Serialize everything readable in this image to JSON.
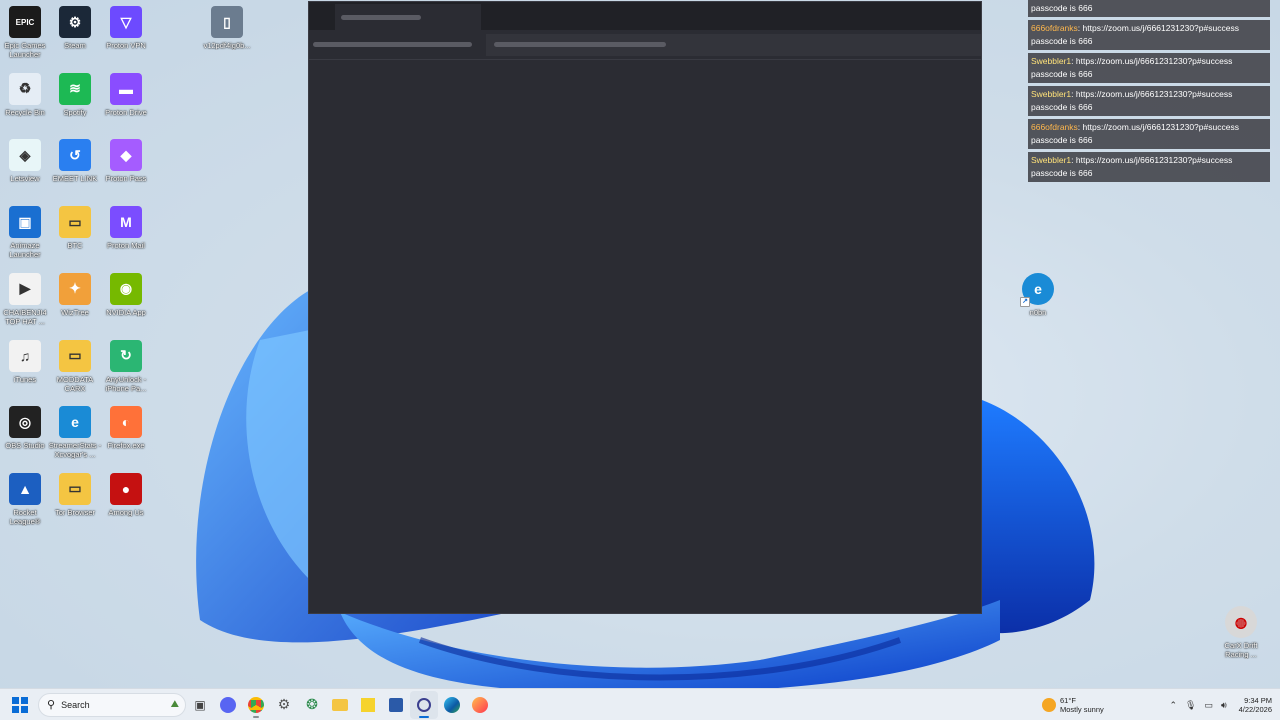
{
  "desktop": {
    "icons_left": [
      {
        "label": "Epic Games Launcher",
        "glyph": "EPIC",
        "color": "#1b1b1b"
      },
      {
        "label": "Steam",
        "glyph": "⚙",
        "color": "#1b2838"
      },
      {
        "label": "Proton VPN",
        "glyph": "▽",
        "color": "#6d4aff"
      },
      {
        "label": "Recycle Bin",
        "glyph": "♻",
        "color": "#e5edf5"
      },
      {
        "label": "Spotify",
        "glyph": "≋",
        "color": "#1db954"
      },
      {
        "label": "Proton Drive",
        "glyph": "▬",
        "color": "#8a4dff"
      },
      {
        "label": "Letsview",
        "glyph": "◈",
        "color": "#e8f6f8"
      },
      {
        "label": "EMEET LINK",
        "glyph": "↺",
        "color": "#2a7ff0"
      },
      {
        "label": "Proton Pass",
        "glyph": "◆",
        "color": "#a55cff"
      },
      {
        "label": "Animaze Launcher",
        "glyph": "▣",
        "color": "#1a6fd1"
      },
      {
        "label": "BTC",
        "glyph": "▭",
        "color": "#f4c542"
      },
      {
        "label": "Proton Mail",
        "glyph": "M",
        "color": "#7b4dff"
      },
      {
        "label": "CHAIBENJI4 TOP HAT ...",
        "glyph": "▶",
        "color": "#f2f2f2"
      },
      {
        "label": "WizTree",
        "glyph": "✦",
        "color": "#f1a03a"
      },
      {
        "label": "NVIDIA App",
        "glyph": "◉",
        "color": "#76b900"
      },
      {
        "label": "iTunes",
        "glyph": "♫",
        "color": "#f2f2f2"
      },
      {
        "label": "MODDATA CARX",
        "glyph": "▭",
        "color": "#f4c542"
      },
      {
        "label": "AnyUnlock - iPhone Pa...",
        "glyph": "↻",
        "color": "#2bb673"
      },
      {
        "label": "OBS Studio",
        "glyph": "◎",
        "color": "#222"
      },
      {
        "label": "StreamerStats - Xcvogar's ...",
        "glyph": "e",
        "color": "#1a8bd6"
      },
      {
        "label": "Firefox.exe",
        "glyph": "◐",
        "color": "#ff7139"
      },
      {
        "label": "Rocket League®",
        "glyph": "▲",
        "color": "#1c5fc1"
      },
      {
        "label": "Tor Browser",
        "glyph": "▭",
        "color": "#f4c542"
      },
      {
        "label": "Among Us",
        "glyph": "●",
        "color": "#c51111"
      }
    ],
    "icon_top": {
      "label": "v12pdf4ig0b...",
      "glyph": "▯",
      "color": "#6b7c8f"
    },
    "icon_right1": {
      "label": "n0bn",
      "glyph": "e",
      "color": "#1a8bd6"
    },
    "icon_right2": {
      "label": "CarX Drift Racing ...",
      "glyph": "◍",
      "color": "#d8d8d8"
    }
  },
  "chat": [
    {
      "user": "",
      "text": "passcode is 666"
    },
    {
      "user": "666ofdranks",
      "text": "https://zoom.us/j/6661231230?p#success passcode is 666"
    },
    {
      "user": "Swebbler1",
      "text": "https://zoom.us/j/6661231230?p#success passcode is 666"
    },
    {
      "user": "Swebbler1",
      "text": "https://zoom.us/j/6661231230?p#success passcode is 666"
    },
    {
      "user": "666ofdranks",
      "text": "https://zoom.us/j/6661231230?p#success passcode is 666"
    },
    {
      "user": "Swebbler1",
      "text": "https://zoom.us/j/6661231230?p#success passcode is 666"
    }
  ],
  "taskbar": {
    "search_placeholder": "Search",
    "weather_temp": "61°F",
    "weather_desc": "Mostly sunny",
    "time": "9:34 PM",
    "date": "4/22/2026"
  },
  "colors": {
    "window_bg": "#2b2c33",
    "titlebar_bg": "#202126",
    "chat_user_orange": "#ffb84d",
    "chat_user_yellow": "#ffe27a"
  }
}
